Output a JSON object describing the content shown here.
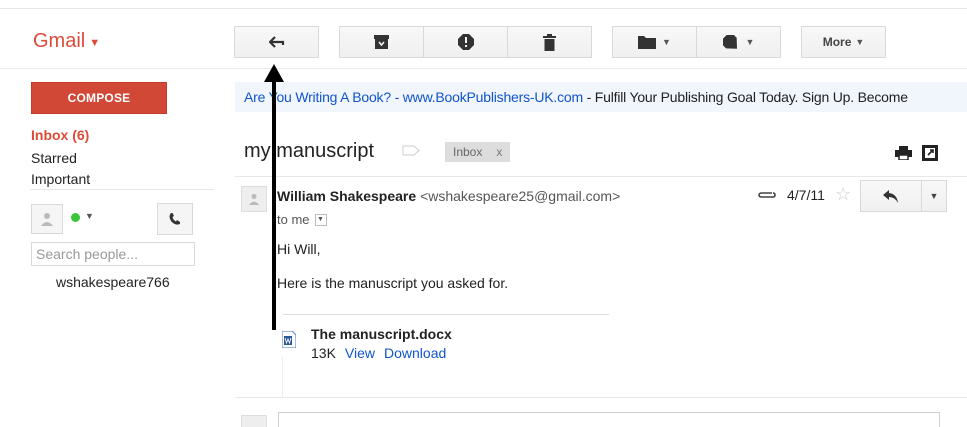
{
  "app": {
    "name": "Gmail"
  },
  "toolbar": {
    "more_label": "More"
  },
  "sidebar": {
    "compose_label": "COMPOSE",
    "inbox_label": "Inbox (6)",
    "starred_label": "Starred",
    "important_label": "Important",
    "search_placeholder": "Search people...",
    "contact_name": "wshakespeare766"
  },
  "ad": {
    "link_text": "Are You Writing A Book? - www.BookPublishers-UK.com",
    "text": " - Fulfill Your Publishing Goal Today. Sign Up. Become"
  },
  "thread": {
    "subject": "my manuscript",
    "label": "Inbox",
    "label_remove": "x"
  },
  "message": {
    "sender_name": "William Shakespeare",
    "sender_email": "<wshakespeare25@gmail.com>",
    "recipient": "to me",
    "date": "4/7/11",
    "greeting": "Hi Will,",
    "body": "Here is the manuscript you asked for.",
    "attachment": {
      "name": "The manuscript.docx",
      "size": "13K",
      "view_label": "View",
      "download_label": "Download"
    }
  },
  "colors": {
    "brand_red": "#dd4b39",
    "compose_red": "#d14836",
    "link_blue": "#1155cc",
    "online_green": "#3ac53a"
  },
  "icons": [
    "back-arrow-icon",
    "archive-icon",
    "spam-icon",
    "trash-icon",
    "folder-icon",
    "tag-icon",
    "print-icon",
    "new-window-icon",
    "paperclip-icon",
    "star-icon",
    "reply-icon",
    "phone-icon",
    "person-icon",
    "document-icon"
  ]
}
